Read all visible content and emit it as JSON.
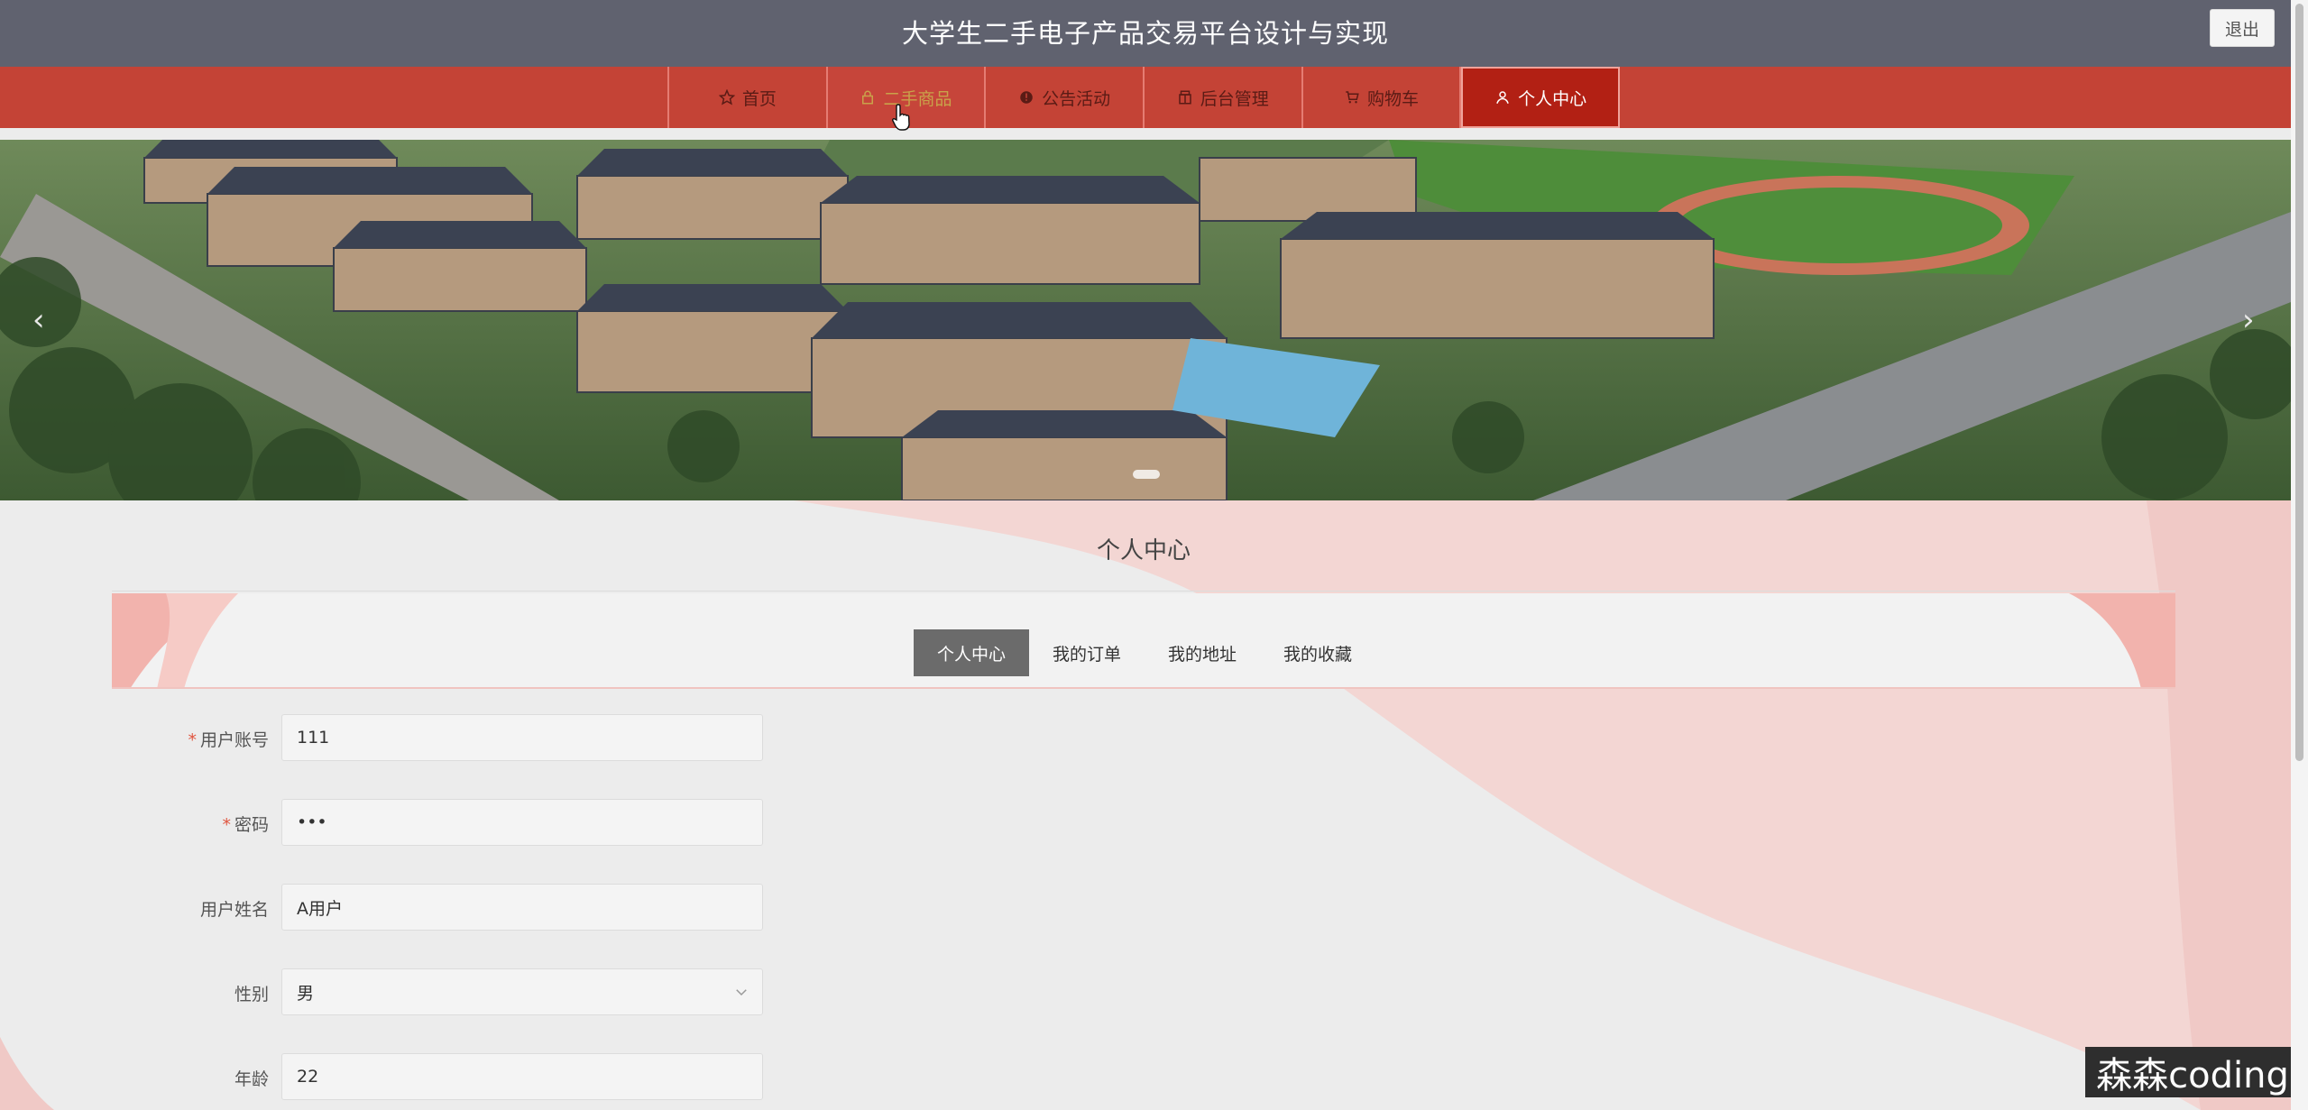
{
  "header": {
    "site_title": "大学生二手电子产品交易平台设计与实现",
    "logout_label": "退出"
  },
  "nav": {
    "items": [
      {
        "label": "首页",
        "icon": "star-icon"
      },
      {
        "label": "二手商品",
        "icon": "lock-bag-icon"
      },
      {
        "label": "公告活动",
        "icon": "info-icon"
      },
      {
        "label": "后台管理",
        "icon": "box-icon"
      },
      {
        "label": "购物车",
        "icon": "cart-icon"
      },
      {
        "label": "个人中心",
        "icon": "user-icon"
      }
    ],
    "hover_index": 1,
    "active_index": 5
  },
  "banner": {
    "prev_label": "‹",
    "next_label": "›"
  },
  "main": {
    "section_title": "个人中心",
    "tabs": [
      {
        "label": "个人中心"
      },
      {
        "label": "我的订单"
      },
      {
        "label": "我的地址"
      },
      {
        "label": "我的收藏"
      }
    ],
    "active_tab": 0
  },
  "form": {
    "fields": [
      {
        "label": "用户账号",
        "required": true,
        "value": "111",
        "type": "text"
      },
      {
        "label": "密码",
        "required": true,
        "value": "•••",
        "type": "password"
      },
      {
        "label": "用户姓名",
        "required": false,
        "value": "A用户",
        "type": "text"
      },
      {
        "label": "性别",
        "required": false,
        "value": "男",
        "type": "select"
      },
      {
        "label": "年龄",
        "required": false,
        "value": "22",
        "type": "text"
      }
    ],
    "required_mark": "*"
  },
  "watermark": "森森coding",
  "colors": {
    "header_bg": "#60626f",
    "nav_bg": "#c44336",
    "nav_active": "#b22014",
    "accent_pink": "#f0c4c0"
  }
}
